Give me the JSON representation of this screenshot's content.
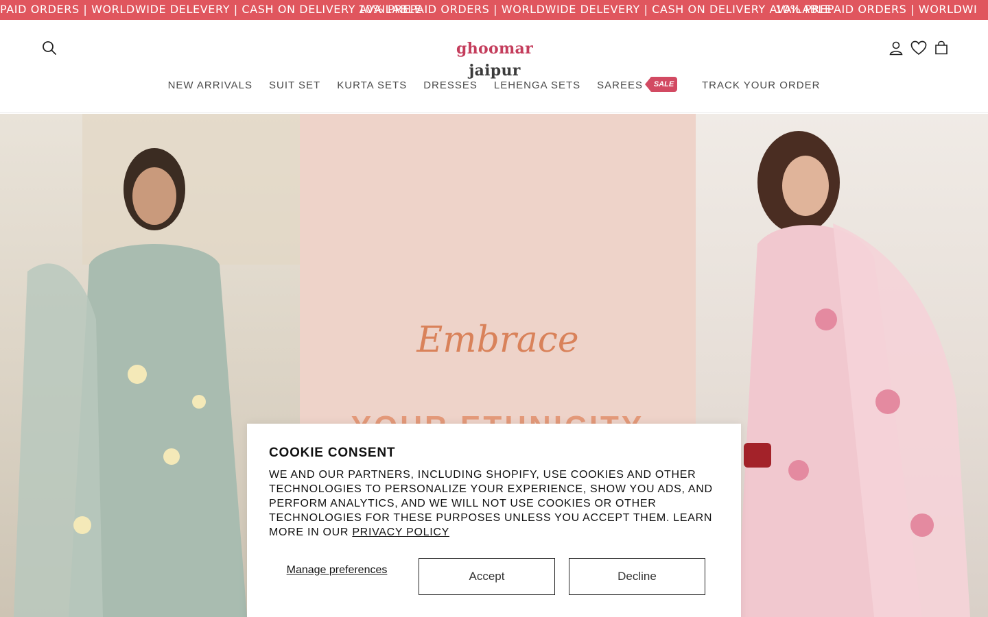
{
  "announcement": {
    "text": "PAID ORDERS | WORLDWIDE DELEVERY | CASH ON DELIVERY AVAILABLE",
    "text_repeat": "10% PREPAID ORDERS | WORLDWIDE DELEVERY | CASH ON DELIVERY AVAILABLE",
    "text_tail": "10% PREPAID ORDERS | WORLDWI"
  },
  "header": {
    "logo_first": "ghoomar",
    "logo_second": "jaipur",
    "icons": [
      "search-icon",
      "account-icon",
      "wishlist-icon",
      "cart-icon"
    ]
  },
  "nav": {
    "items": [
      "NEW ARRIVALS",
      "SUIT SET",
      "KURTA SETS",
      "DRESSES",
      "LEHENGA SETS",
      "SAREES",
      "TRACK YOUR ORDER"
    ],
    "sale_badge": "SALE"
  },
  "hero": {
    "headline_script": "Embrace",
    "headline_caps": "YOUR ETHNICITY"
  },
  "cookie": {
    "title": "COOKIE CONSENT",
    "body": "WE AND OUR PARTNERS, INCLUDING SHOPIFY, USE COOKIES AND OTHER TECHNOLOGIES TO PERSONALIZE YOUR EXPERIENCE, SHOW YOU ADS, AND PERFORM ANALYTICS, AND WE WILL NOT USE COOKIES OR OTHER TECHNOLOGIES FOR THESE PURPOSES UNLESS YOU ACCEPT THEM. LEARN MORE IN OUR",
    "privacy_link": "PRIVACY POLICY",
    "manage": "Manage preferences",
    "accept": "Accept",
    "decline": "Decline"
  },
  "colors": {
    "announcement_bg": "#e0565e",
    "brand_accent": "#c43d5c",
    "hero_center_bg": "#eed3c9"
  }
}
